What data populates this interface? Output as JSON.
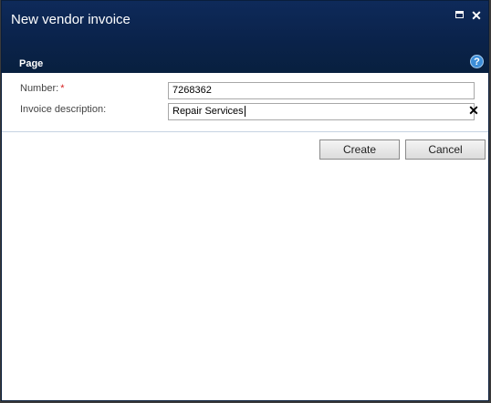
{
  "window": {
    "title": "New vendor invoice",
    "maximize_icon": "maximize-icon",
    "close_icon": "close-icon",
    "close_glyph": "✕"
  },
  "ribbon": {
    "page_tab": "Page",
    "help_glyph": "?"
  },
  "form": {
    "number_label": "Number:",
    "required_marker": "*",
    "number_value": "7268362",
    "description_label": "Invoice description:",
    "description_value": "Repair Services",
    "clear_glyph": "✕"
  },
  "buttons": {
    "create": "Create",
    "cancel": "Cancel"
  },
  "colors": {
    "titlebar": "#0b2450",
    "accent": "#3d8ed8",
    "required": "#d62020"
  }
}
